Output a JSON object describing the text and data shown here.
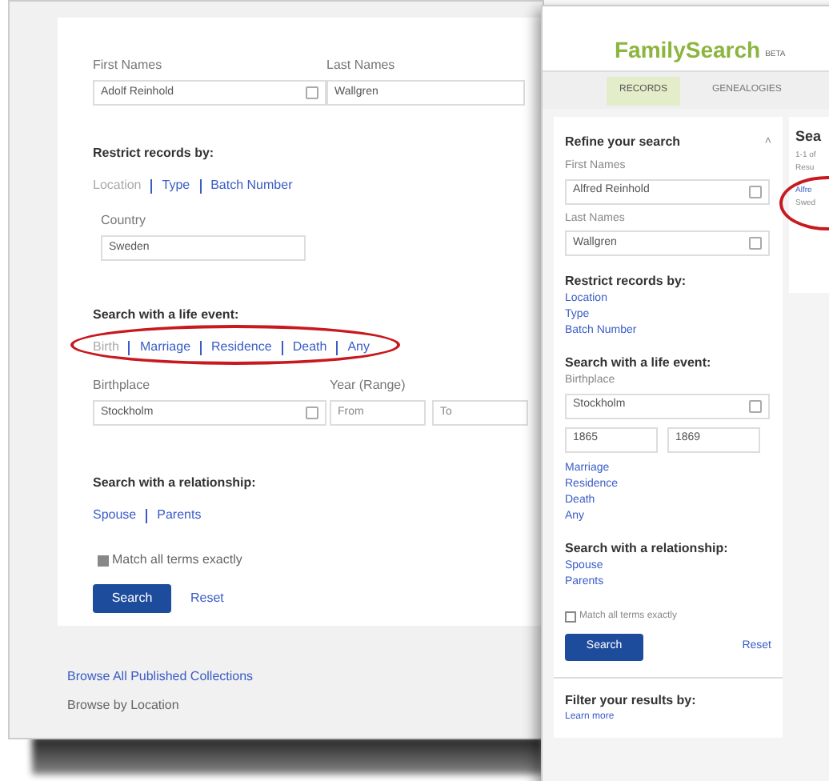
{
  "back_window": {
    "name_fields": [
      {
        "label": "First Names",
        "value": "Adolf Reinhold",
        "kind": "picker"
      },
      {
        "label": "Last Names",
        "value": "Wallgren",
        "kind": "text"
      }
    ],
    "restrict": {
      "heading": "Restrict records by:",
      "links": [
        {
          "label": "Location",
          "selected": true
        },
        {
          "label": "Type",
          "selected": false
        },
        {
          "label": "Batch Number",
          "selected": false
        }
      ]
    },
    "country": {
      "label": "Country",
      "value": "Sweden"
    },
    "life_event": {
      "heading": "Search with a life event:",
      "circled": true,
      "links": [
        {
          "label": "Birth",
          "selected": true
        },
        {
          "label": "Marriage",
          "selected": false
        },
        {
          "label": "Residence",
          "selected": false
        },
        {
          "label": "Death",
          "selected": false
        },
        {
          "label": "Any",
          "selected": false
        }
      ]
    },
    "place": {
      "label": "Birthplace",
      "value": "Stockholm"
    },
    "year": {
      "label": "Year (Range)",
      "from": {
        "placeholder": "From"
      },
      "to": {
        "placeholder": "To"
      }
    },
    "relationship": {
      "heading": "Search with a relationship:",
      "links": [
        {
          "label": "Spouse",
          "selected": false
        },
        {
          "label": "Parents",
          "selected": false
        }
      ]
    },
    "match": {
      "label": "Match all terms exactly",
      "checked": true
    },
    "search_button": "Search",
    "reset": "Reset",
    "footer": [
      {
        "label": "Browse All Published Collections",
        "kind": "link"
      },
      {
        "label": "Browse by Location",
        "kind": "text"
      }
    ]
  },
  "front_window": {
    "logo": "FamilySearch",
    "logo_badge": "BETA",
    "tabs": [
      {
        "label": "RECORDS",
        "selected": true
      },
      {
        "label": "GENEALOGIES",
        "selected": false
      }
    ],
    "sidebar": {
      "title": "Refine your search",
      "collapse": "˄",
      "fields": [
        {
          "label": "First Names",
          "value": "Alfred Reinhold"
        },
        {
          "label": "Last Names",
          "value": "Wallgren"
        }
      ],
      "restrict_heading": "Restrict records by:",
      "restrict_links": [
        "Location",
        "Type",
        "Batch Number"
      ],
      "life_heading": "Search with a life event:",
      "place": {
        "label": "Birthplace",
        "value": "Stockholm"
      },
      "years": [
        "1865",
        "1869"
      ],
      "life_links": [
        "Marriage",
        "Residence",
        "Death",
        "Any"
      ],
      "relationship_heading": "Search with a relationship:",
      "relationship_links": [
        "Spouse",
        "Parents"
      ],
      "match": {
        "label": "Match all terms exactly",
        "checked": false
      },
      "search_button": "Search",
      "reset": "Reset",
      "filter_heading": "Filter your results by:",
      "learn_more": "Learn more"
    },
    "results": {
      "title": "Sea",
      "circled": true,
      "lines": [
        {
          "text": "1-1 of",
          "kind": "text"
        },
        {
          "text": "Resu",
          "kind": "text"
        },
        {
          "text": "Alfre",
          "kind": "link"
        },
        {
          "text": "Swed",
          "kind": "text"
        }
      ]
    }
  }
}
